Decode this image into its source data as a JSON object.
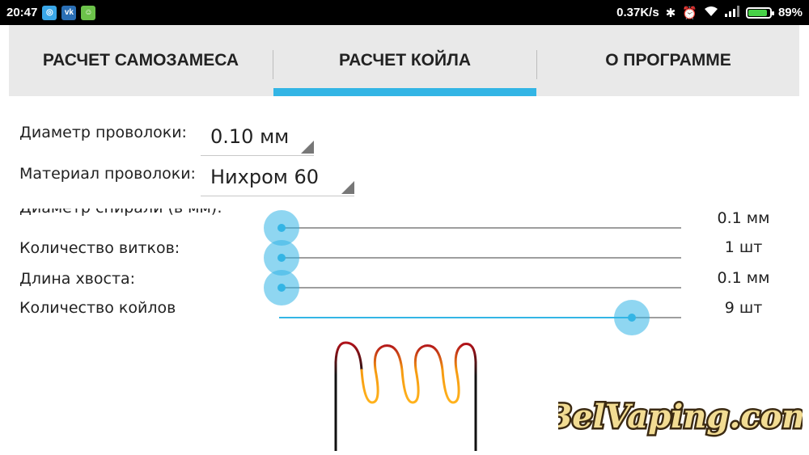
{
  "status_bar": {
    "time": "20:47",
    "app_icons": [
      "app-icon",
      "vk-icon",
      "android-icon"
    ],
    "network_speed": "0.37K/s",
    "battery_percent": "89%",
    "battery_level": 0.89
  },
  "tabs": [
    {
      "label": "РАСЧЕТ САМОЗАМЕСА",
      "active": false
    },
    {
      "label": "РАСЧЕТ КОЙЛА",
      "active": true
    },
    {
      "label": "О ПРОГРАММЕ",
      "active": false
    }
  ],
  "form": {
    "wire_diameter": {
      "label": "Диаметр проволоки:",
      "value": "0.10 мм"
    },
    "wire_material": {
      "label": "Материал проволоки:",
      "value": "Нихром 60"
    },
    "sliders": [
      {
        "label": "Диаметр спирали (в мм):",
        "value_text": "0.1 мм",
        "level": 0.0
      },
      {
        "label": "Количество витков:",
        "value_text": "1 шт",
        "level": 0.0
      },
      {
        "label": "Длина хвоста:",
        "value_text": "0.1 мм",
        "level": 0.0
      },
      {
        "label": "Количество койлов",
        "value_text": "9 шт",
        "level": 0.89
      }
    ]
  },
  "watermark": {
    "text": "BelVaping.com"
  },
  "colors": {
    "accent": "#33b5e5",
    "tab_bg": "#e9e9e9",
    "status_bar": "#000000",
    "battery": "#47d147"
  }
}
